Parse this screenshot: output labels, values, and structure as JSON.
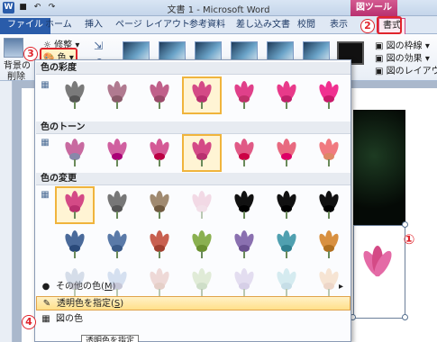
{
  "window": {
    "title": "文書 1 - Microsoft Word",
    "context_tab_title": "図ツール"
  },
  "qat": {
    "word_icon": "W",
    "undo": "↶",
    "redo": "↷"
  },
  "tabs": [
    {
      "id": "file",
      "label": "ファイル"
    },
    {
      "id": "home",
      "label": "ホーム"
    },
    {
      "id": "insert",
      "label": "挿入"
    },
    {
      "id": "pagelayout",
      "label": "ページ レイアウト"
    },
    {
      "id": "references",
      "label": "参考資料"
    },
    {
      "id": "mailings",
      "label": "差し込み文書"
    },
    {
      "id": "review",
      "label": "校閲"
    },
    {
      "id": "view",
      "label": "表示"
    },
    {
      "id": "format",
      "label": "書式"
    }
  ],
  "ribbon": {
    "bg_remove_label": "背景の",
    "bg_remove_label2": "削除",
    "corrections_label": "修整",
    "color_label": "色",
    "border_label": "図の枠線",
    "effects_label": "図の効果",
    "layout_label": "図のレイアウト"
  },
  "panel": {
    "sections": {
      "saturation": "色の彩度",
      "tone": "色のトーン",
      "recolor": "色の変更"
    },
    "menu": {
      "more_colors": "その他の色(",
      "more_colors_key": "M",
      "more_colors_tail": ")",
      "set_transparent": "透明色を指定(",
      "set_transparent_key": "S",
      "set_transparent_tail": ")",
      "picture_color": "図の色"
    },
    "tooltip": "透明色を指定"
  },
  "callouts": {
    "c1": "①",
    "c2": "2",
    "c3": "3",
    "c4": "4"
  },
  "colors": {
    "accent": "#d44a86",
    "highlight": "#ffe08a",
    "callout_red": "#e0242c"
  }
}
